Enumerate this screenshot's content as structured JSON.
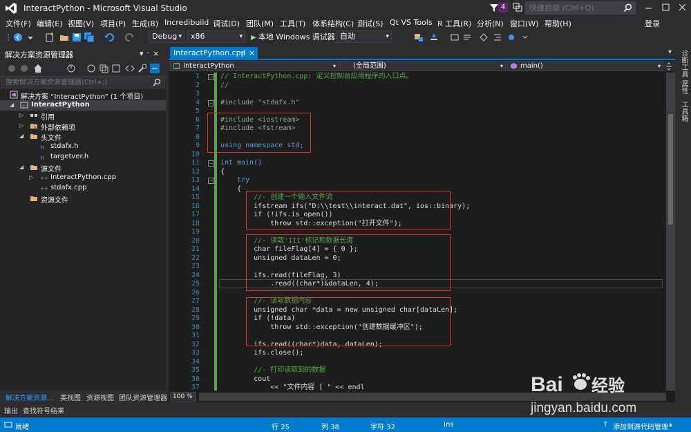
{
  "titlebar": {
    "title": "InteractPython - Microsoft Visual Studio",
    "notification_count": "4",
    "quick_launch_placeholder": "快速启动 (Ctrl+Q)",
    "accent": "#68217a"
  },
  "menu": [
    "文件(F)",
    "编辑(E)",
    "视图(V)",
    "项目(P)",
    "生成(B)",
    "Incredibuild",
    "调试(D)",
    "团队(M)",
    "工具(T)",
    "体系结构(C)",
    "测试(S)",
    "Qt VS Tools",
    "R 工具(R)",
    "分析(N)",
    "窗口(W)",
    "帮助(H)"
  ],
  "signin": "登录",
  "toolbar": {
    "config": "Debug",
    "platform": "x86",
    "run_label": "本地 Windows 调试器",
    "auto": "自动"
  },
  "solution_explorer": {
    "title": "解决方案资源管理器",
    "pin": "▾ ᛫ ×",
    "search_placeholder": "搜索解决方案资源管理器(Ctrl+;)",
    "tree": [
      {
        "label": "解决方案 “InteractPython” (1 个项目)",
        "icon": "solution-icon"
      },
      {
        "label": "InteractPython",
        "icon": "project-icon"
      },
      {
        "label": "引用",
        "icon": "references-icon"
      },
      {
        "label": "外部依赖项",
        "icon": "dependencies-icon"
      },
      {
        "label": "头文件",
        "icon": "folder-icon"
      },
      {
        "label": "stdafx.h",
        "icon": "header-file-icon"
      },
      {
        "label": "targetver.h",
        "icon": "header-file-icon"
      },
      {
        "label": "源文件",
        "icon": "folder-icon"
      },
      {
        "label": "InteractPython.cpp",
        "icon": "cpp-file-icon"
      },
      {
        "label": "stdafx.cpp",
        "icon": "cpp-file-icon"
      },
      {
        "label": "资源文件",
        "icon": "folder-icon"
      }
    ],
    "tabs": [
      "解决方案资源...",
      "类视图",
      "资源视图",
      "团队资源管理器"
    ]
  },
  "editor": {
    "tab_label": "InteractPython.cpp",
    "tab_pin": "⊣",
    "tab_close": "×",
    "nav_project": "InteractPython",
    "nav_scope": "(全局范围)",
    "nav_member": "main()",
    "zoom": "100 %"
  },
  "code_lines": [
    {
      "n": "1",
      "t": "// InteractPython.cpp: 定义控制台应用程序的入口点。"
    },
    {
      "n": "2",
      "t": "//"
    },
    {
      "n": "3",
      "t": ""
    },
    {
      "n": "4",
      "t": "#include \"stdafx.h\""
    },
    {
      "n": "5",
      "t": ""
    },
    {
      "n": "6",
      "t": "#include <iostream>"
    },
    {
      "n": "7",
      "t": "#include <fstream>"
    },
    {
      "n": "8",
      "t": ""
    },
    {
      "n": "9",
      "t": "using namespace std;"
    },
    {
      "n": "10",
      "t": ""
    },
    {
      "n": "11",
      "t": "int main()"
    },
    {
      "n": "12",
      "t": "{"
    },
    {
      "n": "13",
      "t": "    try"
    },
    {
      "n": "14",
      "t": "    {"
    },
    {
      "n": "15",
      "t": "        //- 创建一个输入文件流"
    },
    {
      "n": "16",
      "t": "        ifstream ifs(\"D:\\\\test\\\\interact.dat\", ios::binary);"
    },
    {
      "n": "17",
      "t": "        if (!ifs.is_open())"
    },
    {
      "n": "18",
      "t": "            throw std::exception(\"打开文件\");"
    },
    {
      "n": "19",
      "t": ""
    },
    {
      "n": "20",
      "t": "        //- 读取'III'标记和数据长度"
    },
    {
      "n": "21",
      "t": "        char fileFlag[4] = { 0 };"
    },
    {
      "n": "22",
      "t": "        unsigned dataLen = 0;"
    },
    {
      "n": "23",
      "t": ""
    },
    {
      "n": "24",
      "t": "        ifs.read(fileFlag, 3)"
    },
    {
      "n": "25",
      "t": "            .read((char*)&dataLen, 4);"
    },
    {
      "n": "26",
      "t": ""
    },
    {
      "n": "27",
      "t": "        //- 读取数据内容"
    },
    {
      "n": "28",
      "t": "        unsigned char *data = new unsigned char[dataLen];"
    },
    {
      "n": "29",
      "t": "        if (!data)"
    },
    {
      "n": "30",
      "t": "            throw std::exception(\"创建数据缓冲区\");"
    },
    {
      "n": "31",
      "t": ""
    },
    {
      "n": "32",
      "t": "        ifs.read((char*)data, dataLen);"
    },
    {
      "n": "33",
      "t": "        ifs.close();"
    },
    {
      "n": "34",
      "t": ""
    },
    {
      "n": "35",
      "t": "        //- 打印读取到的数据"
    },
    {
      "n": "36",
      "t": "        cout"
    },
    {
      "n": "37",
      "t": "            << \"文件内容 [ \" << endl"
    }
  ],
  "right_tabs": [
    "诊断工具",
    "属性",
    "工具箱"
  ],
  "output_tabs": [
    "输出",
    "查找符号结果"
  ],
  "status": {
    "ready": "就绪",
    "line": "行 25",
    "col": "列 38",
    "char": "字符 32",
    "mode": "Ins",
    "add_source": "添加到源代码管理"
  },
  "watermark": {
    "brand": "Bai",
    "brand2": "经验",
    "url": "jingyan.baidu.com"
  }
}
